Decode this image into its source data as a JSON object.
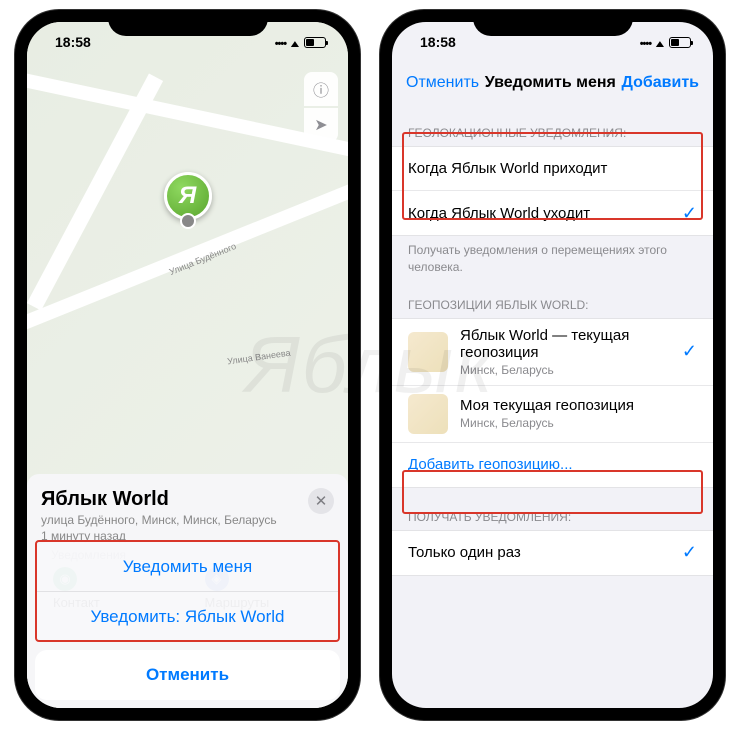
{
  "status": {
    "time": "18:58"
  },
  "left": {
    "pin_letter": "Я",
    "road1": "Улица Будённого",
    "road2": "Улица Ванеева",
    "card": {
      "title": "Яблык World",
      "address": "улица Будённого, Минск, Минск, Беларусь",
      "time": "1 минуту назад"
    },
    "chips": {
      "contact": "Контакт",
      "routes": "Маршруты"
    },
    "sheet": {
      "notify_me": "Уведомить меня",
      "notify_other": "Уведомить: Яблык World",
      "cancel": "Отменить"
    },
    "peek_label": "Уведомления"
  },
  "right": {
    "nav": {
      "cancel": "Отменить",
      "title": "Уведомить меня",
      "add": "Добавить"
    },
    "sec1_header": "ГЕОЛОКАЦИОННЫЕ УВЕДОМЛЕНИЯ:",
    "opt_arrive": "Когда Яблык World приходит",
    "opt_leave": "Когда Яблык World уходит",
    "sec1_footer": "Получать уведомления о перемещениях этого человека.",
    "sec2_header": "ГЕОПОЗИЦИИ ЯБЛЫК WORLD:",
    "loc1_title": "Яблык World — текущая геопозиция",
    "loc1_sub": "Минск, Беларусь",
    "loc2_title": "Моя текущая геопозиция",
    "loc2_sub": "Минск, Беларусь",
    "add_location": "Добавить геопозицию...",
    "sec3_header": "ПОЛУЧАТЬ УВЕДОМЛЕНИЯ:",
    "freq_once": "Только один раз"
  }
}
